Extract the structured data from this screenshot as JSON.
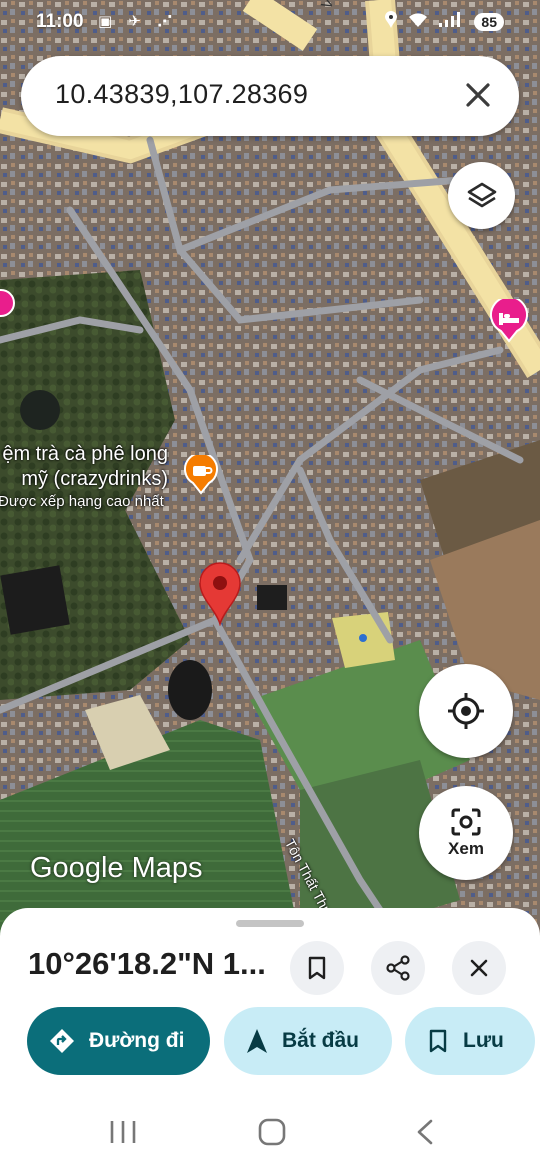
{
  "status_bar": {
    "time": "11:00",
    "left_icons": "▣ ✈ ⋰",
    "battery": "85"
  },
  "search": {
    "value": "10.43839,107.28369"
  },
  "map": {
    "road_label_top": "Võ",
    "road_label": "Tôn Thất Thuyết",
    "place_name_line1": "ệm trà cà phê long",
    "place_name_line2": "mỹ (crazydrinks)",
    "place_rating": "Được xếp hạng cao nhất",
    "logo": "Google Maps",
    "lens_label": "Xem"
  },
  "sheet": {
    "title": "10°26'18.2\"N 1...",
    "directions_label": "Đường đi",
    "start_label": "Bắt đầu",
    "save_label": "Lưu"
  },
  "colors": {
    "accent": "#0b6e7a",
    "tonal": "#c8ecf6",
    "pin": "#e53935",
    "poi_orange": "#f57c00",
    "poi_pink": "#e91e8c"
  }
}
